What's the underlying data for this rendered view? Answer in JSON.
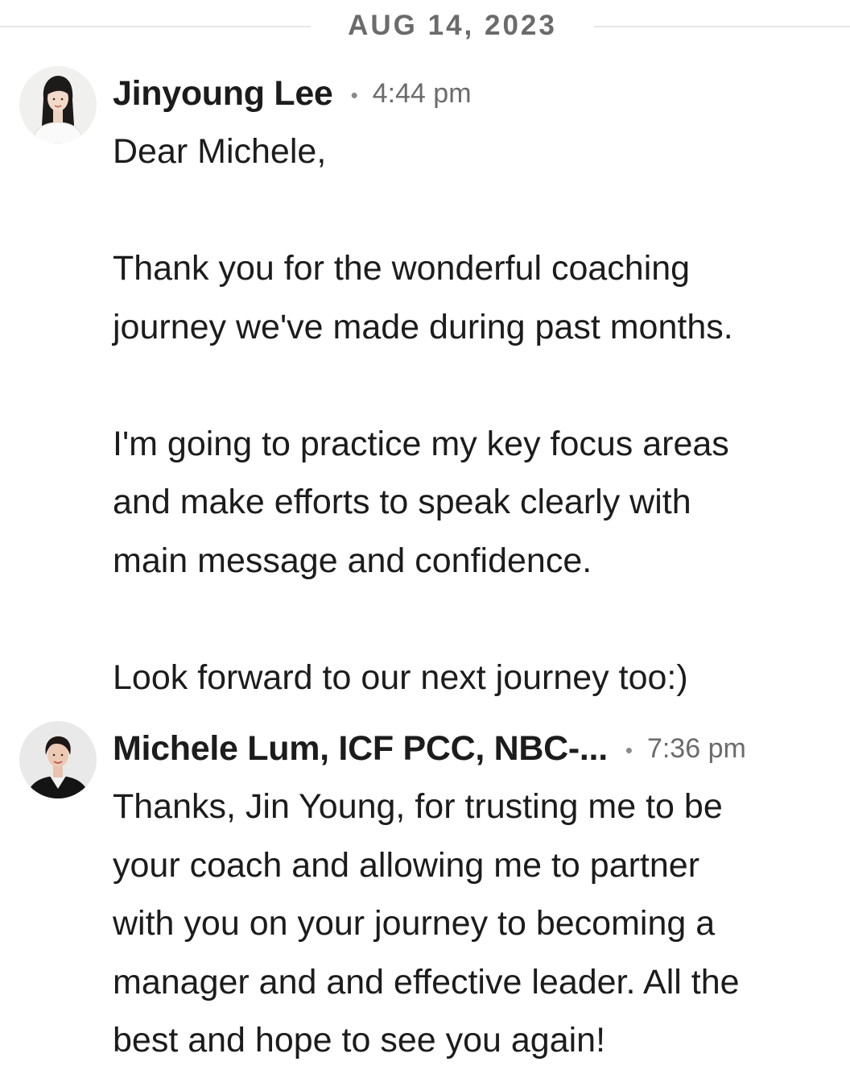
{
  "date_divider": "AUG 14, 2023",
  "messages": [
    {
      "sender": "Jinyoung Lee",
      "separator": "•",
      "time": "4:44 pm",
      "avatar_icon": "profile-photo-woman-long-hair",
      "paragraphs": [
        "Dear Michele,",
        "",
        "Thank you for the wonderful coaching",
        "journey we've made during past months.",
        "",
        "I'm going to practice my key focus areas",
        "and make efforts to speak clearly with",
        "main message and confidence.",
        "",
        "Look forward to our next journey too:)"
      ]
    },
    {
      "sender": "Michele Lum, ICF PCC, NBC-...",
      "separator": "•",
      "time": "7:36 pm",
      "avatar_icon": "profile-photo-woman-short-hair",
      "paragraphs": [
        "Thanks, Jin Young, for trusting me to be",
        "your coach and allowing me to partner",
        "with you on your journey to becoming a",
        "manager and and effective leader. All the",
        "best and hope to see you again!"
      ]
    }
  ]
}
